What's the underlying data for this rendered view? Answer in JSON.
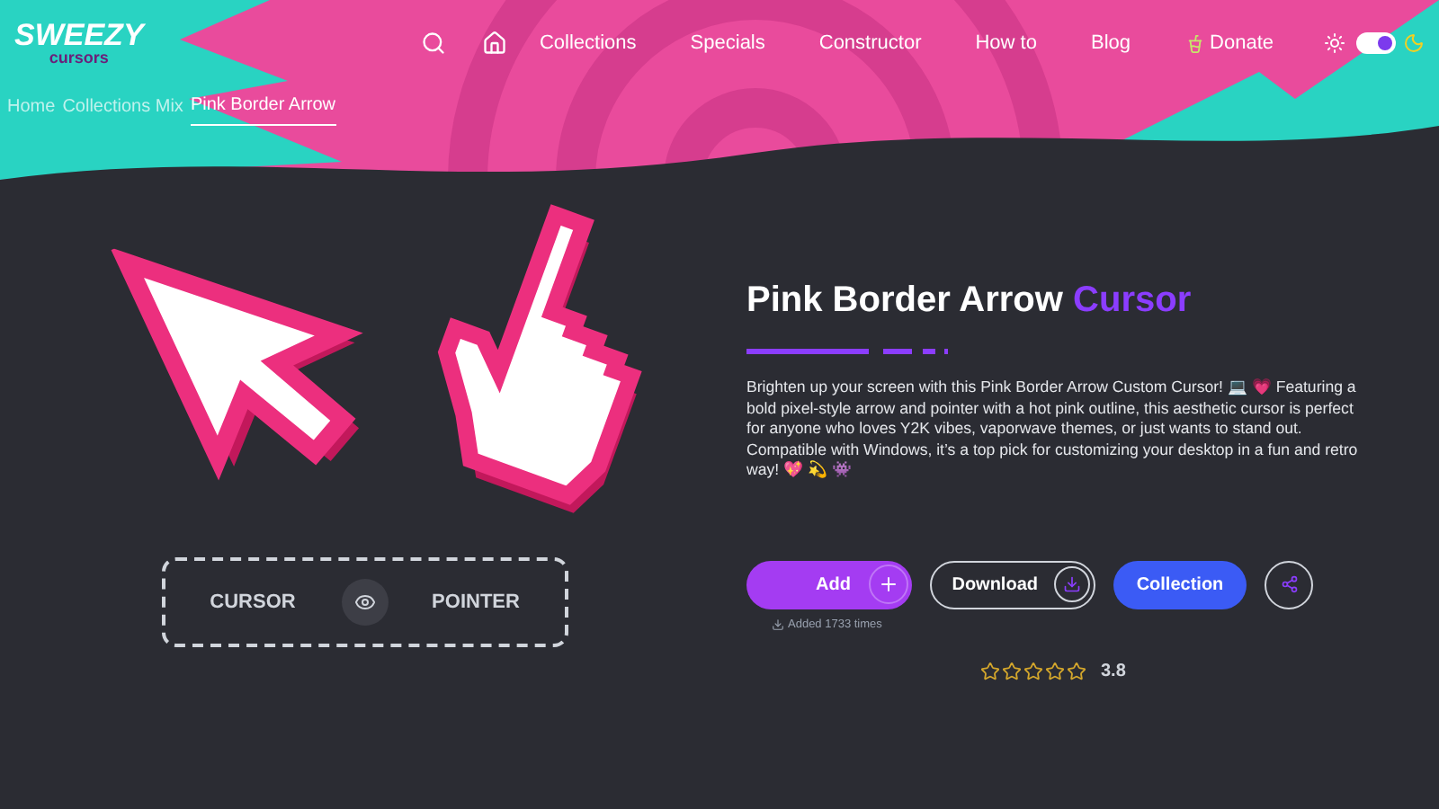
{
  "logo": {
    "name": "SWEEZY",
    "tagline": "cursors"
  },
  "nav": [
    {
      "label": "Collections"
    },
    {
      "label": "Specials"
    },
    {
      "label": "Constructor"
    },
    {
      "label": "How to"
    },
    {
      "label": "Blog"
    },
    {
      "label": "Donate",
      "kind": "donate"
    }
  ],
  "theme_toggle": {
    "on": true
  },
  "breadcrumbs": [
    {
      "label": "Home",
      "selected": false
    },
    {
      "label": "Collections Mix",
      "selected": false
    },
    {
      "label": "Pink Border Arrow",
      "selected": true
    }
  ],
  "preview": {
    "left": "CURSOR",
    "right": "POINTER"
  },
  "title": {
    "main": "Pink Border Arrow",
    "accent": "Cursor"
  },
  "description": "Brighten up your screen with this Pink Border Arrow Custom Cursor! 💻 💗 Featuring a bold pixel-style arrow and pointer with a hot pink outline, this aesthetic cursor is perfect for anyone who loves Y2K vibes, vaporwave themes, or just wants to stand out. Compatible with Windows, it’s a top pick for customizing your desktop in a fun and retro way! 💖 💫 👾",
  "actions": {
    "add": "Add",
    "download": "Download",
    "collection": "Collection",
    "added_note": "Added 1733 times"
  },
  "rating": {
    "stars": 0,
    "value": "3.8"
  }
}
